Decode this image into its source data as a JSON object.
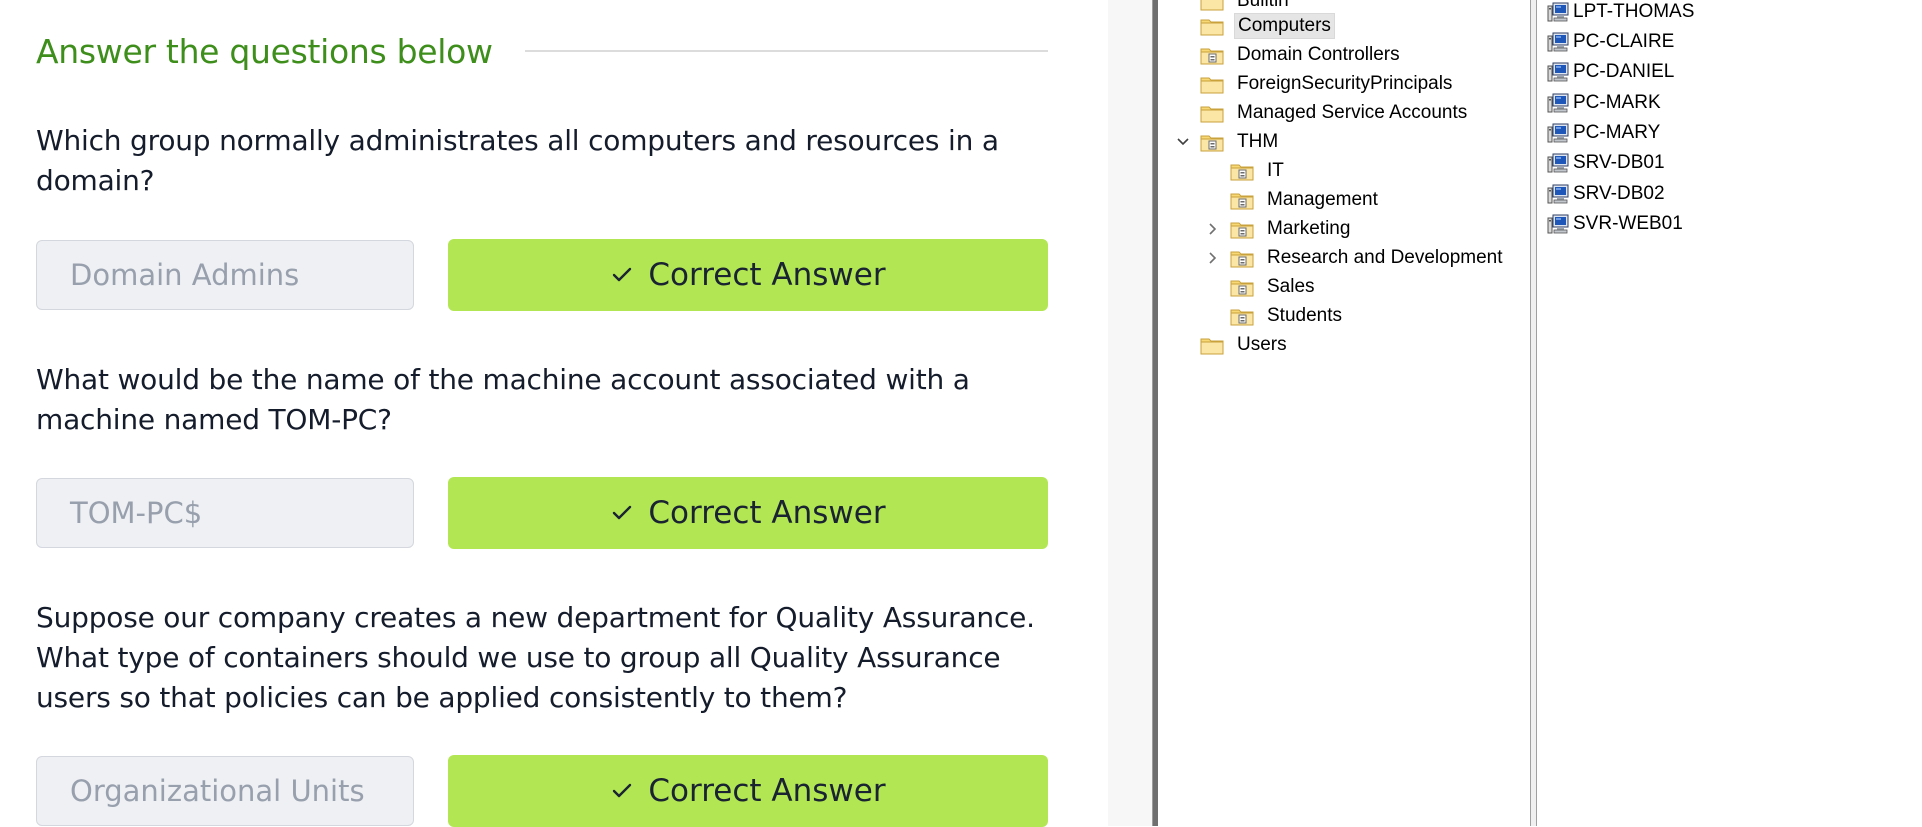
{
  "task": {
    "heading": "Answer the questions below",
    "questions": [
      {
        "text": "Which group normally administrates all computers and resources in a domain?",
        "answer": "Domain Admins",
        "status": "Correct Answer"
      },
      {
        "text": "What would be the name of the machine account associated with a machine named TOM-PC?",
        "answer": "TOM-PC$",
        "status": "Correct Answer"
      },
      {
        "text": "Suppose our company creates a new department for Quality Assurance. What type of containers should we use to group all Quality Assurance users so that policies can be applied consistently to them?",
        "answer": "Organizational Units",
        "status": "Correct Answer"
      }
    ]
  },
  "tree": {
    "items": [
      {
        "label": "Builtin",
        "icon": "folder-icon"
      },
      {
        "label": "Computers",
        "icon": "folder-icon",
        "selected": true
      },
      {
        "label": "Domain Controllers",
        "icon": "ou-folder-icon"
      },
      {
        "label": "ForeignSecurityPrincipals",
        "icon": "folder-icon"
      },
      {
        "label": "Managed Service Accounts",
        "icon": "folder-icon"
      },
      {
        "label": "THM",
        "icon": "ou-folder-icon",
        "expanded": true
      },
      {
        "label": "IT",
        "icon": "ou-folder-icon"
      },
      {
        "label": "Management",
        "icon": "ou-folder-icon"
      },
      {
        "label": "Marketing",
        "icon": "ou-folder-icon",
        "collapsed": true
      },
      {
        "label": "Research and Development",
        "icon": "ou-folder-icon",
        "collapsed": true
      },
      {
        "label": "Sales",
        "icon": "ou-folder-icon"
      },
      {
        "label": "Students",
        "icon": "ou-folder-icon"
      },
      {
        "label": "Users",
        "icon": "folder-icon"
      }
    ]
  },
  "computers": {
    "items": [
      "LPT-THOMAS",
      "PC-CLAIRE",
      "PC-DANIEL",
      "PC-MARK",
      "PC-MARY",
      "SRV-DB01",
      "SRV-DB02",
      "SVR-WEB01"
    ]
  },
  "colors": {
    "heading": "#3e8e1c",
    "correct_button": "#b2e653",
    "input_background": "#eef0f4"
  }
}
